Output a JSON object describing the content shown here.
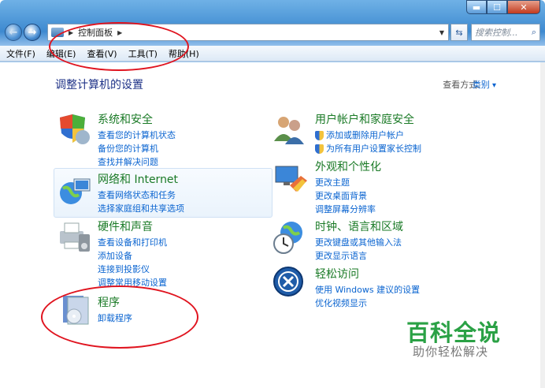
{
  "window": {
    "min_label": "▬",
    "max_label": "☐",
    "close_label": "✕"
  },
  "address": {
    "path_label": "控制面板",
    "search_placeholder": "搜索控制...",
    "refresh_glyph": "⇆",
    "search_glyph": "⌕"
  },
  "menu": [
    "文件(F)",
    "编辑(E)",
    "查看(V)",
    "工具(T)",
    "帮助(H)"
  ],
  "page": {
    "title": "调整计算机的设置",
    "view_label": "查看方式:",
    "view_value": "类别"
  },
  "categories": {
    "security": {
      "title": "系统和安全",
      "links": [
        "查看您的计算机状态",
        "备份您的计算机",
        "查找并解决问题"
      ]
    },
    "network": {
      "title": "网络和 Internet",
      "links": [
        "查看网络状态和任务",
        "选择家庭组和共享选项"
      ]
    },
    "hardware": {
      "title": "硬件和声音",
      "links": [
        "查看设备和打印机",
        "添加设备",
        "连接到投影仪",
        "调整常用移动设置"
      ]
    },
    "programs": {
      "title": "程序",
      "links": [
        "卸载程序"
      ]
    },
    "users": {
      "title": "用户帐户和家庭安全",
      "links": [
        "添加或删除用户帐户",
        "为所有用户设置家长控制"
      ]
    },
    "appearance": {
      "title": "外观和个性化",
      "links": [
        "更改主题",
        "更改桌面背景",
        "调整屏幕分辨率"
      ]
    },
    "clock": {
      "title": "时钟、语言和区域",
      "links": [
        "更改键盘或其他输入法",
        "更改显示语言"
      ]
    },
    "ease": {
      "title": "轻松访问",
      "links": [
        "使用 Windows 建议的设置",
        "优化视频显示"
      ]
    }
  },
  "watermark": {
    "title": "百科全说",
    "subtitle": "助你轻松解决"
  },
  "colors": {
    "heading_green": "#1a7a26",
    "link_blue": "#0a64d0",
    "annotation_red": "#e0141f"
  }
}
